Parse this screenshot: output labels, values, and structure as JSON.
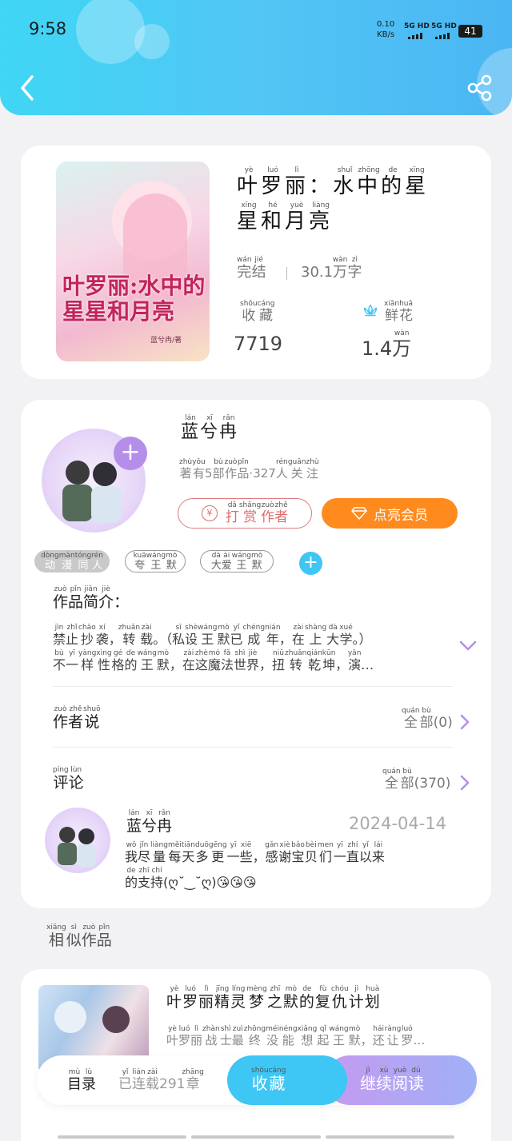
{
  "status_bar": {
    "time": "9:58",
    "net_speed": "0.10",
    "net_unit": "KB/s",
    "sim1": "5G HD",
    "sim2": "5G HD",
    "battery": "41"
  },
  "colors": {
    "header_gradient_start": "#3fd6f5",
    "header_gradient_end": "#4ab6f3",
    "vip_orange": "#ff8a1d",
    "tip_red": "#e06a6a",
    "read_purple": "#b98df0",
    "collect_blue": "#3ec6f5"
  },
  "book": {
    "title_line1": [
      [
        "叶",
        "yè"
      ],
      [
        "罗",
        "luó"
      ],
      [
        "丽",
        "lì"
      ],
      [
        "：",
        ""
      ],
      [
        "水",
        "shuǐ"
      ],
      [
        "中",
        "zhōng"
      ],
      [
        "的",
        "de"
      ],
      [
        "星",
        "xīng"
      ]
    ],
    "title_line2": [
      [
        "星",
        "xīng"
      ],
      [
        "和",
        "hé"
      ],
      [
        "月",
        "yuè"
      ],
      [
        "亮",
        "liàng"
      ]
    ],
    "status": [
      [
        "完",
        "wán"
      ],
      [
        "结",
        "jié"
      ]
    ],
    "word_count": "30.1",
    "word_unit": [
      [
        "万",
        "wàn"
      ],
      [
        "字",
        "zì"
      ]
    ],
    "collect_label": [
      [
        "收",
        "shōu"
      ],
      [
        "藏",
        "cáng"
      ]
    ],
    "collect_count": "7719",
    "flower_label": [
      [
        "鲜",
        "xiān"
      ],
      [
        "花",
        "huā"
      ]
    ],
    "flower_count": "1.4",
    "flower_unit": [
      [
        "万",
        "wàn"
      ]
    ],
    "cover_title": "叶罗丽:水中的星星和月亮",
    "cover_author": "蓝兮冉/著"
  },
  "author": {
    "name": [
      [
        "蓝",
        "lán"
      ],
      [
        "兮",
        "xī"
      ],
      [
        "冉",
        "rǎn"
      ]
    ],
    "stats": [
      [
        "著",
        "zhù"
      ],
      [
        "有",
        "yǒu"
      ],
      [
        "5",
        ""
      ],
      [
        "部",
        "bù"
      ],
      [
        "作",
        "zuò"
      ],
      [
        "品",
        "pǐn"
      ],
      [
        "·327",
        ""
      ],
      [
        "人",
        "rén"
      ],
      [
        "关",
        "guān"
      ],
      [
        "注",
        "zhù"
      ]
    ],
    "tip_button": [
      [
        "打",
        "dǎ"
      ],
      [
        "赏",
        "shǎng"
      ],
      [
        "作",
        "zuò"
      ],
      [
        "者",
        "zhě"
      ]
    ],
    "vip_button": "点亮会员"
  },
  "tags": [
    [
      [
        "动",
        "dòng"
      ],
      [
        "漫",
        "màn"
      ],
      [
        "同",
        "tóng"
      ],
      [
        "人",
        "rén"
      ]
    ],
    [
      [
        "夸",
        "kuā"
      ],
      [
        "王",
        "wáng"
      ],
      [
        "默",
        "mò"
      ]
    ],
    [
      [
        "大",
        "dà"
      ],
      [
        "爱",
        "ài"
      ],
      [
        "王",
        "wáng"
      ],
      [
        "默",
        "mò"
      ]
    ]
  ],
  "intro": {
    "title": [
      [
        "作",
        "zuò"
      ],
      [
        "品",
        "pǐn"
      ],
      [
        "简",
        "jiǎn"
      ],
      [
        "介",
        "jiè"
      ],
      [
        "：",
        ""
      ]
    ],
    "line1": [
      [
        "禁",
        "jìn"
      ],
      [
        "止",
        "zhǐ"
      ],
      [
        "抄",
        "chāo"
      ],
      [
        "袭",
        "xí"
      ],
      [
        "，",
        ""
      ],
      [
        "转",
        "zhuǎn"
      ],
      [
        "载",
        "zài"
      ],
      [
        "。（",
        ""
      ],
      [
        "私",
        "sī"
      ],
      [
        "设",
        "shè"
      ],
      [
        "王",
        "wáng"
      ],
      [
        "默",
        "mò"
      ],
      [
        "已",
        "yǐ"
      ],
      [
        "成",
        "chéng"
      ],
      [
        "年",
        "nián"
      ],
      [
        "，",
        ""
      ],
      [
        "在",
        "zài"
      ],
      [
        "上",
        "shàng"
      ],
      [
        "大",
        "dà"
      ],
      [
        "学",
        "xué"
      ],
      [
        "。）",
        ""
      ]
    ],
    "line2": [
      [
        "不",
        "bù"
      ],
      [
        "一",
        "yī"
      ],
      [
        "样",
        "yàng"
      ],
      [
        "性",
        "xìng"
      ],
      [
        "格",
        "gé"
      ],
      [
        "的",
        "de"
      ],
      [
        "王",
        "wáng"
      ],
      [
        "默",
        "mò"
      ],
      [
        "，",
        ""
      ],
      [
        "在",
        "zài"
      ],
      [
        "这",
        "zhè"
      ],
      [
        "魔",
        "mó"
      ],
      [
        "法",
        "fǎ"
      ],
      [
        "世",
        "shì"
      ],
      [
        "界",
        "jiè"
      ],
      [
        "，",
        ""
      ],
      [
        "扭",
        "niǔ"
      ],
      [
        "转",
        "zhuǎn"
      ],
      [
        "乾",
        "qián"
      ],
      [
        "坤",
        "kūn"
      ],
      [
        "，",
        ""
      ],
      [
        "演",
        "yǎn"
      ],
      [
        "…",
        ""
      ]
    ]
  },
  "author_says": {
    "title": [
      [
        "作",
        "zuò"
      ],
      [
        "者",
        "zhě"
      ],
      [
        "说",
        "shuō"
      ]
    ],
    "all": [
      [
        "全",
        "quán"
      ],
      [
        "部",
        "bù"
      ],
      [
        "(0)",
        ""
      ]
    ]
  },
  "comments": {
    "title": [
      [
        "评",
        "píng"
      ],
      [
        "论",
        "lùn"
      ]
    ],
    "all": [
      [
        "全",
        "quán"
      ],
      [
        "部",
        "bù"
      ],
      [
        "(370)",
        ""
      ]
    ],
    "item": {
      "user": [
        [
          "蓝",
          "lán"
        ],
        [
          "兮",
          "xī"
        ],
        [
          "冉",
          "rǎn"
        ]
      ],
      "date": "2024-04-14",
      "line1": [
        [
          "我",
          "wǒ"
        ],
        [
          "尽",
          "jǐn"
        ],
        [
          "量",
          "liàng"
        ],
        [
          "每",
          "měi"
        ],
        [
          "天",
          "tiān"
        ],
        [
          "多",
          "duō"
        ],
        [
          "更",
          "gēng"
        ],
        [
          "一",
          "yī"
        ],
        [
          "些",
          "xiē"
        ],
        [
          "，",
          ""
        ],
        [
          "感",
          "gǎn"
        ],
        [
          "谢",
          "xiè"
        ],
        [
          "宝",
          "bǎo"
        ],
        [
          "贝",
          "bèi"
        ],
        [
          "们",
          "men"
        ],
        [
          "一",
          "yī"
        ],
        [
          "直",
          "zhí"
        ],
        [
          "以",
          "yǐ"
        ],
        [
          "来",
          "lái"
        ]
      ],
      "line2": [
        [
          "的",
          "de"
        ],
        [
          "支",
          "zhī"
        ],
        [
          "持",
          "chí"
        ],
        [
          "(ღ˘‿˘ღ)😘😘😘",
          ""
        ]
      ]
    }
  },
  "similar": {
    "title": [
      [
        "相",
        "xiāng"
      ],
      [
        "似",
        "sì"
      ],
      [
        "作",
        "zuò"
      ],
      [
        "品",
        "pǐn"
      ]
    ],
    "book_title": [
      [
        "叶",
        "yè"
      ],
      [
        "罗",
        "luó"
      ],
      [
        "丽",
        "lì"
      ],
      [
        "精",
        "jīng"
      ],
      [
        "灵",
        "líng"
      ],
      [
        "梦",
        "mèng"
      ],
      [
        "之",
        "zhī"
      ],
      [
        "默",
        "mò"
      ],
      [
        "的",
        "de"
      ],
      [
        "复",
        "fù"
      ],
      [
        "仇",
        "chóu"
      ],
      [
        "计",
        "jì"
      ],
      [
        "划",
        "huà"
      ]
    ],
    "book_desc": [
      [
        "叶",
        "yè"
      ],
      [
        "罗",
        "luó"
      ],
      [
        "丽",
        "lì"
      ],
      [
        "战",
        "zhàn"
      ],
      [
        "士",
        "shì"
      ],
      [
        "最",
        "zuì"
      ],
      [
        "终",
        "zhōng"
      ],
      [
        "没",
        "méi"
      ],
      [
        "能",
        "néng"
      ],
      [
        "想",
        "xiǎng"
      ],
      [
        "起",
        "qǐ"
      ],
      [
        "王",
        "wáng"
      ],
      [
        "默",
        "mò"
      ],
      [
        "，",
        ""
      ],
      [
        "还",
        "hái"
      ],
      [
        "让",
        "ràng"
      ],
      [
        "罗",
        "luó"
      ],
      [
        "…",
        ""
      ]
    ]
  },
  "bottom_bar": {
    "catalog": [
      [
        "目",
        "mù"
      ],
      [
        "录",
        "lù"
      ]
    ],
    "chapters": [
      [
        "已",
        "yǐ"
      ],
      [
        "连",
        "lián"
      ],
      [
        "载",
        "zài"
      ],
      [
        "291",
        ""
      ],
      [
        "章",
        "zhāng"
      ]
    ],
    "collect": [
      [
        "收",
        "shōu"
      ],
      [
        "藏",
        "cáng"
      ]
    ],
    "read": [
      [
        "继",
        "jì"
      ],
      [
        "续",
        "xù"
      ],
      [
        "阅",
        "yuè"
      ],
      [
        "读",
        "dú"
      ]
    ]
  }
}
